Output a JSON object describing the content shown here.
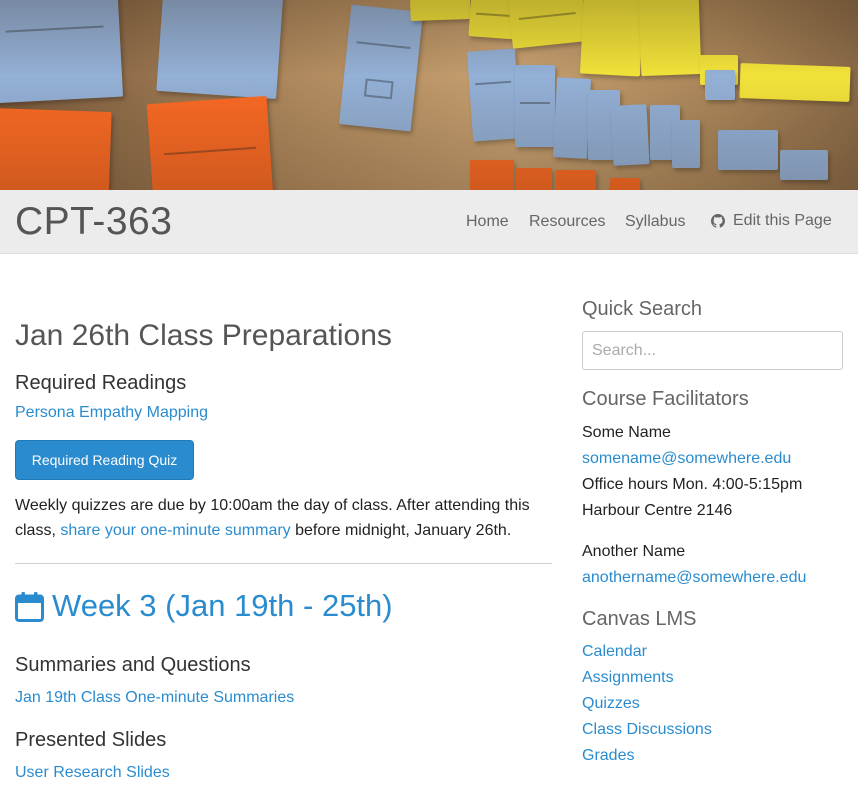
{
  "site": {
    "title": "CPT-363"
  },
  "nav": {
    "home": "Home",
    "resources": "Resources",
    "syllabus": "Syllabus",
    "edit": "Edit this Page",
    "edit_icon": "github-icon"
  },
  "main": {
    "page_title": "Jan 26th Class Preparations",
    "required_readings": {
      "heading": "Required Readings",
      "link": "Persona Empathy Mapping",
      "button": "Required Reading Quiz"
    },
    "notice": {
      "text_before": "Weekly quizzes are due by 10:00am the day of class. After attending this class,",
      "link": "share your one-minute summary",
      "text_after": "before midnight, January 26th."
    },
    "week": {
      "icon": "calendar-icon",
      "title": "Week 3 (Jan 19th - 25th)"
    },
    "summaries": {
      "heading": "Summaries and Questions",
      "link": "Jan 19th Class One-minute Summaries"
    },
    "slides": {
      "heading": "Presented Slides",
      "link": "User Research Slides"
    }
  },
  "sidebar": {
    "search": {
      "heading": "Quick Search",
      "placeholder": "Search..."
    },
    "facilitators": {
      "heading": "Course Facilitators",
      "people": [
        {
          "name": "Some Name",
          "email": "somename@somewhere.edu",
          "hours": "Office hours Mon. 4:00-5:15pm",
          "room": "Harbour Centre 2146"
        },
        {
          "name": "Another Name",
          "email": "anothername@somewhere.edu"
        }
      ]
    },
    "canvas": {
      "heading": "Canvas LMS",
      "links": [
        "Calendar",
        "Assignments",
        "Quizzes",
        "Class Discussions",
        "Grades"
      ]
    }
  },
  "colors": {
    "accent": "#2a8ccf",
    "navbar": "#ececec",
    "button": "#2a8ccf"
  }
}
